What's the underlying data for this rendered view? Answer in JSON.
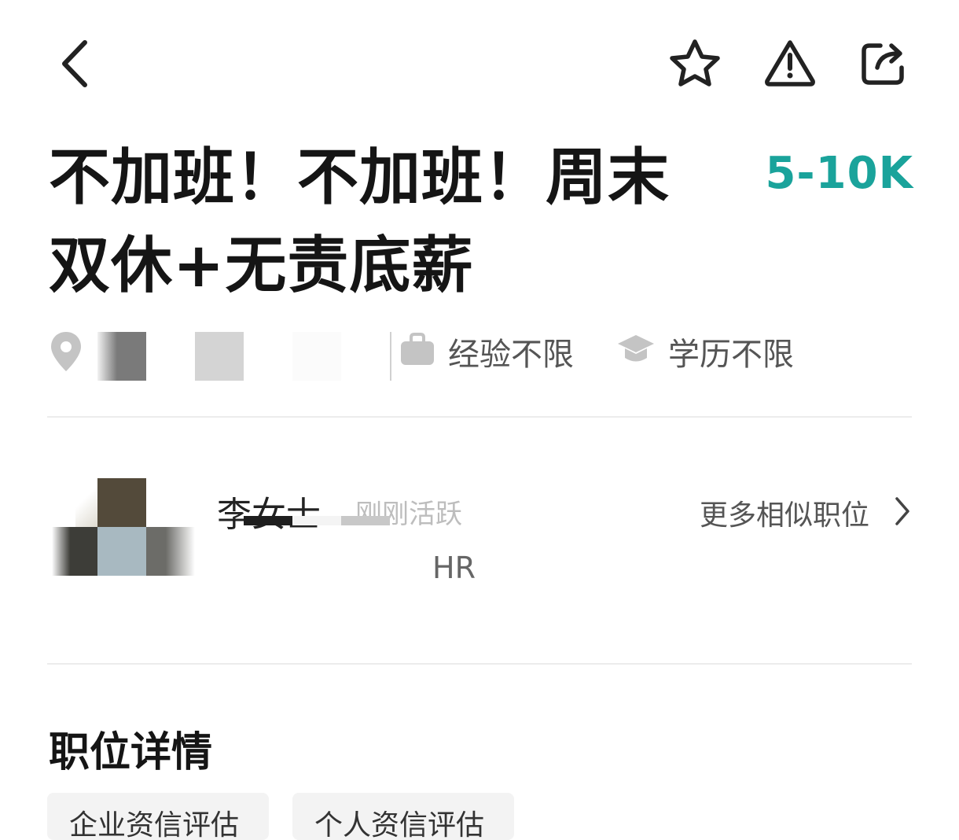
{
  "header": {
    "icons": [
      "chevron-left-icon",
      "star-icon",
      "warning-icon",
      "share-icon"
    ]
  },
  "job": {
    "title_line1": "不加班！不加班！周末",
    "title_line2": "双休+无责底薪",
    "salary": "5-10K",
    "salary_color": "#1aa39b"
  },
  "tags": {
    "experience": "经验不限",
    "education": "学历不限"
  },
  "hr": {
    "name": "李女士",
    "active_status": "刚刚活跃",
    "role": "HR",
    "more_link": "更多相似职位"
  },
  "details": {
    "section_title": "职位详情",
    "chips": [
      "企业资信评估",
      "个人资信评估"
    ]
  }
}
